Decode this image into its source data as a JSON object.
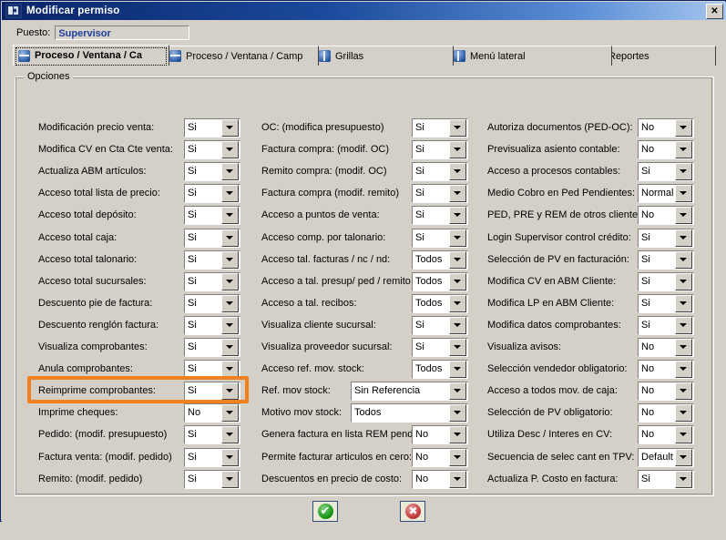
{
  "window": {
    "title": "Modificar permiso",
    "icon": "app-window-icon",
    "close_label": "✕"
  },
  "header": {
    "puesto_label": "Puesto:",
    "puesto_value": "Supervisor"
  },
  "tabs": [
    {
      "label": "Proceso / Ventana / Ca",
      "icon": "window-icon",
      "active": true
    },
    {
      "label": "Proceso / Ventana / Camp",
      "icon": "window-icon",
      "active": false
    },
    {
      "label": "Grillas",
      "icon": "grid-icon",
      "active": false
    },
    {
      "label": "Menú lateral",
      "icon": "menu-icon",
      "active": false
    },
    {
      "label": "Reportes",
      "icon": "report-icon",
      "active": false
    }
  ],
  "group": {
    "legend": "Opciones"
  },
  "columns": [
    {
      "name": "column-1",
      "fields": [
        {
          "label": "Modificación precio venta:",
          "value": "Si"
        },
        {
          "label": "Modifica CV en Cta Cte venta:",
          "value": "Si"
        },
        {
          "label": "Actualiza ABM artículos:",
          "value": "Si"
        },
        {
          "label": "Acceso total lista de precio:",
          "value": "Si"
        },
        {
          "label": "Acceso total depósito:",
          "value": "Si"
        },
        {
          "label": "Acceso total caja:",
          "value": "Si"
        },
        {
          "label": "Acceso total talonario:",
          "value": "Si"
        },
        {
          "label": "Acceso total sucursales:",
          "value": "Si"
        },
        {
          "label": "Descuento pie de factura:",
          "value": "Si"
        },
        {
          "label": "Descuento renglón factura:",
          "value": "Si"
        },
        {
          "label": "Visualiza comprobantes:",
          "value": "Si"
        },
        {
          "label": "Anula comprobantes:",
          "value": "Si"
        },
        {
          "label": "Reimprime comprobantes:",
          "value": "Si",
          "highlighted": true
        },
        {
          "label": "Imprime cheques:",
          "value": "No"
        },
        {
          "label": "Pedido: (modif. presupuesto)",
          "value": "Si"
        },
        {
          "label": "Factura venta: (modif. pedido)",
          "value": "Si"
        },
        {
          "label": "Remito: (modif. pedido)",
          "value": "Si"
        }
      ]
    },
    {
      "name": "column-2",
      "fields": [
        {
          "label": "OC: (modifica presupuesto)",
          "value": "Si"
        },
        {
          "label": "Factura compra: (modif. OC)",
          "value": "Si"
        },
        {
          "label": "Remito compra: (modif. OC)",
          "value": "Si"
        },
        {
          "label": "Factura compra (modif. remito)",
          "value": "Si"
        },
        {
          "label": "Acceso a puntos de venta:",
          "value": "Si"
        },
        {
          "label": "Acceso comp. por talonario:",
          "value": "Si"
        },
        {
          "label": "Acceso tal. facturas / nc / nd:",
          "value": "Todos"
        },
        {
          "label": "Acceso a tal. presup/ ped / remito",
          "value": "Todos"
        },
        {
          "label": "Acceso a tal. recibos:",
          "value": "Todos"
        },
        {
          "label": "Visualiza cliente sucursal:",
          "value": "Si"
        },
        {
          "label": "Visualiza proveedor sucursal:",
          "value": "Si"
        },
        {
          "label": "Acceso ref. mov. stock:",
          "value": "Todos"
        },
        {
          "label": "Ref. mov stock:",
          "value": "Sin Referencia",
          "wide": true
        },
        {
          "label": "Motivo mov stock:",
          "value": "Todos",
          "wide": true
        },
        {
          "label": "Genera factura en lista REM pend:",
          "value": "No"
        },
        {
          "label": "Permite facturar articulos en cero:",
          "value": "No"
        },
        {
          "label": "Descuentos en precio de costo:",
          "value": "No"
        }
      ]
    },
    {
      "name": "column-3",
      "fields": [
        {
          "label": "Autoriza documentos (PED-OC):",
          "value": "No"
        },
        {
          "label": "Previsualiza asiento contable:",
          "value": "No"
        },
        {
          "label": "Acceso a procesos contables:",
          "value": "Si"
        },
        {
          "label": "Medio Cobro en Ped Pendientes:",
          "value": "Normal"
        },
        {
          "label": "PED, PRE y REM de otros clientes:",
          "value": "No"
        },
        {
          "label": "Login Supervisor control crédito:",
          "value": "Si"
        },
        {
          "label": "Selección de PV en facturación:",
          "value": "Si"
        },
        {
          "label": "Modifica CV en ABM Cliente:",
          "value": "Si"
        },
        {
          "label": "Modifica LP en ABM Cliente:",
          "value": "Si"
        },
        {
          "label": "Modifica datos comprobantes:",
          "value": "Si"
        },
        {
          "label": "Visualiza avisos:",
          "value": "No"
        },
        {
          "label": "Selección vendedor obligatorio:",
          "value": "No"
        },
        {
          "label": "Acceso a todos mov. de caja:",
          "value": "No"
        },
        {
          "label": "Selección de PV obligatorio:",
          "value": "No"
        },
        {
          "label": "Utiliza Desc / Interes en CV:",
          "value": "No"
        },
        {
          "label": "Secuencia de selec cant en TPV:",
          "value": "Default"
        },
        {
          "label": "Actualiza P. Costo en factura:",
          "value": "Si"
        }
      ]
    }
  ],
  "footer": {
    "accept": {
      "name": "accept-button",
      "glyph": "✔"
    },
    "cancel": {
      "name": "cancel-button",
      "glyph": "✖"
    }
  },
  "colors": {
    "titlebar_start": "#0a246a",
    "titlebar_end": "#a6c6ee",
    "face": "#d4d0c8",
    "highlight": "#f08020",
    "field_text": "#1f3f9e"
  }
}
